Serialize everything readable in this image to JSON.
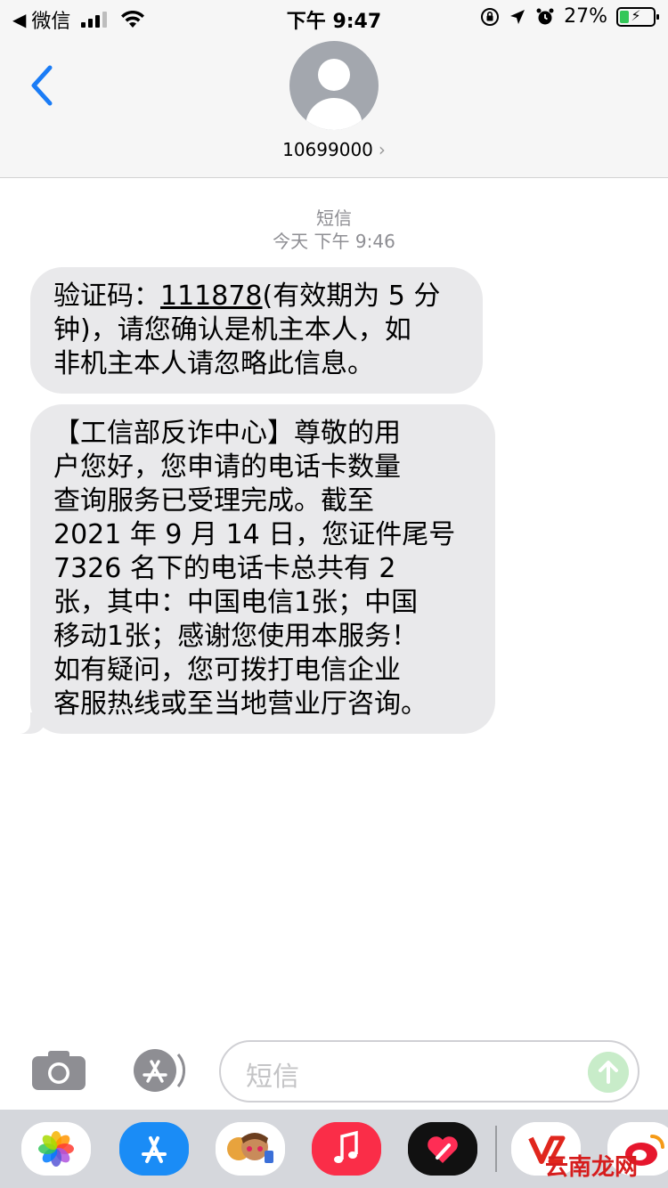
{
  "status_bar": {
    "back_app": "微信",
    "time": "下午 9:47",
    "battery_percent": "27%",
    "battery_level": 0.27
  },
  "header": {
    "contact_number": "10699000",
    "chevron": "›"
  },
  "thread": {
    "service_label": "短信",
    "timestamp": "今天 下午 9:46",
    "messages": [
      {
        "prefix": "验证码：",
        "link": "111878",
        "rest": "(有效期为 5 分\n钟)，请您确认是机主本人，如\n非机主本人请忽略此信息。"
      },
      {
        "text": "【工信部反诈中心】尊敬的用\n户您好，您申请的电话卡数量\n查询服务已受理完成。截至\n2021 年 9 月 14 日，您证件尾号\n7326 名下的电话卡总共有 2\n张，其中：中国电信1张；中国\n移动1张；感谢您使用本服务！\n如有疑问，您可拨打电信企业\n客服热线或至当地营业厅咨询。"
      }
    ]
  },
  "input": {
    "placeholder": "短信"
  },
  "app_drawer": {
    "apps": [
      "photos-icon",
      "app-store-icon",
      "memoji-icon",
      "music-icon",
      "digital-touch-icon",
      "app6-icon",
      "weibo-icon"
    ]
  },
  "watermark": "云南龙网",
  "colors": {
    "bubble": "#e9e9eb",
    "accent": "#1a7cf6",
    "battery_fill": "#34c759",
    "send_disabled": "#c8ecc9"
  }
}
